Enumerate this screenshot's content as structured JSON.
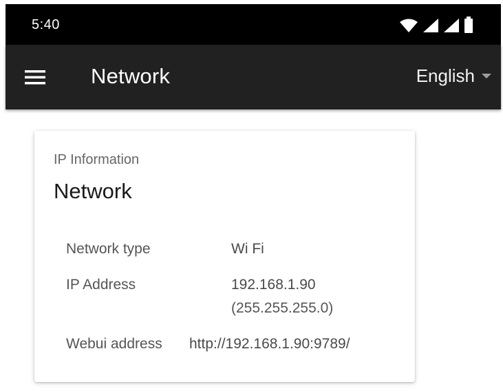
{
  "status_bar": {
    "time": "5:40",
    "icons": [
      "wifi-icon",
      "signal-icon",
      "signal-icon",
      "battery-icon"
    ]
  },
  "app_bar": {
    "title": "Network",
    "menu_icon": "menu-icon",
    "language": {
      "selected": "English",
      "icon": "chevron-down-icon"
    }
  },
  "card": {
    "overline": "IP Information",
    "title": "Network",
    "rows": [
      {
        "label": "Network type",
        "value": "Wi Fi"
      },
      {
        "label": "IP Address",
        "value": "192.168.1.90",
        "secondary": "(255.255.255.0)"
      },
      {
        "label": "Webui address",
        "value": "http://192.168.1.90:9789/"
      }
    ]
  },
  "colors": {
    "status_bar_bg": "#000000",
    "app_bar_bg": "#212121",
    "card_bg": "#ffffff",
    "muted_text": "#666666"
  }
}
